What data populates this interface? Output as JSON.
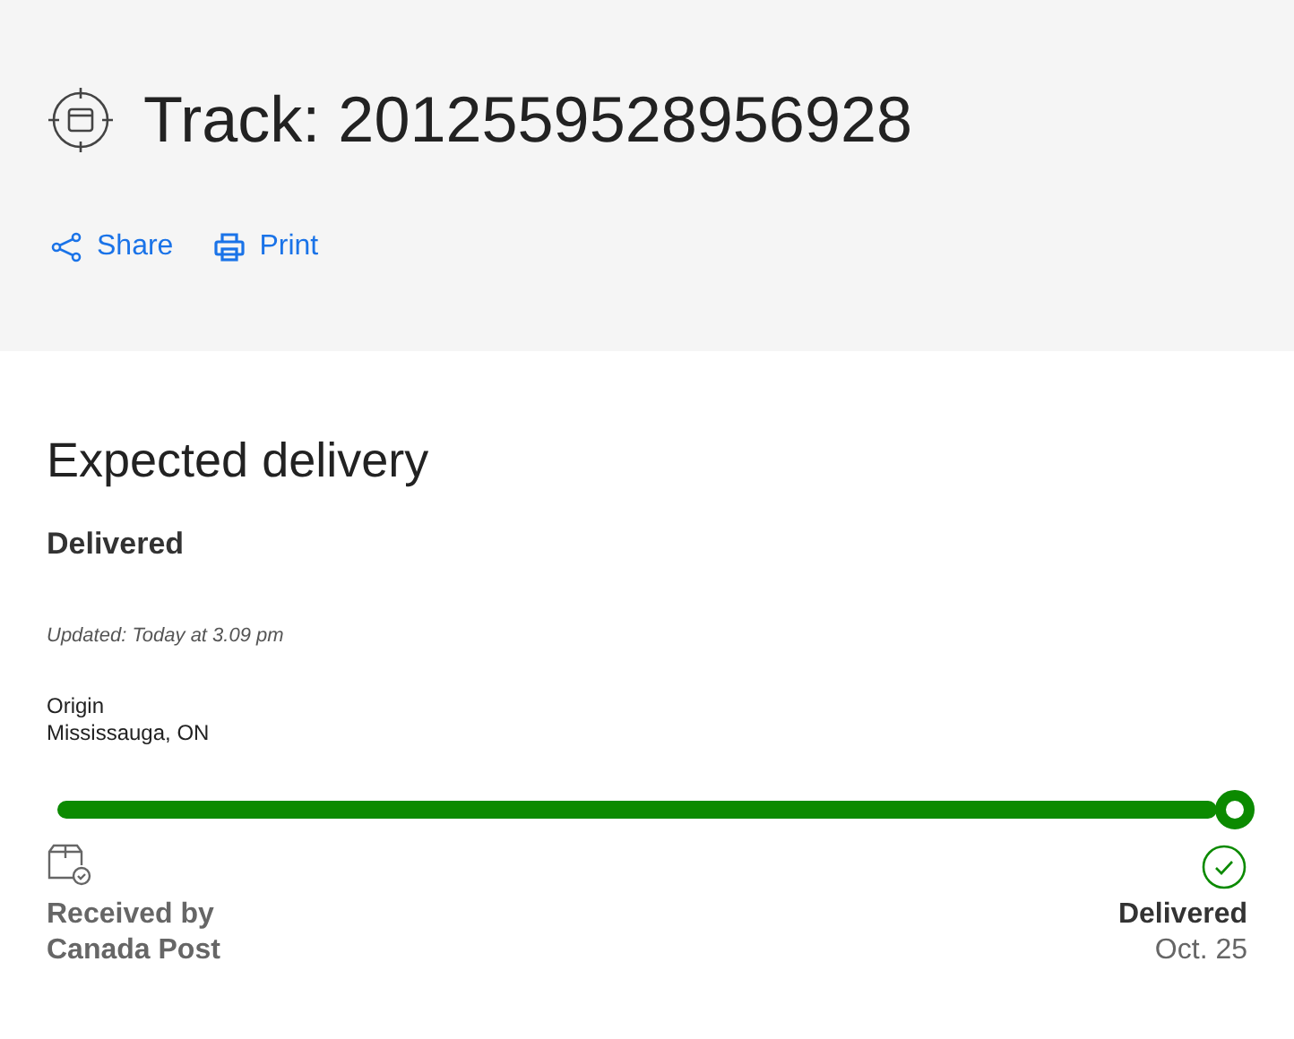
{
  "header": {
    "title": "Track: 2012559528956928",
    "actions": [
      {
        "kind": "share",
        "label": "Share"
      },
      {
        "kind": "print",
        "label": "Print"
      }
    ]
  },
  "delivery": {
    "heading": "Expected delivery",
    "status": "Delivered",
    "updated": "Updated: Today at 3.09 pm",
    "origin_label": "Origin",
    "origin": "Mississauga, ON",
    "start": {
      "line1": "Received by",
      "line2": "Canada Post"
    },
    "end": {
      "status": "Delivered",
      "date": "Oct. 25"
    }
  }
}
